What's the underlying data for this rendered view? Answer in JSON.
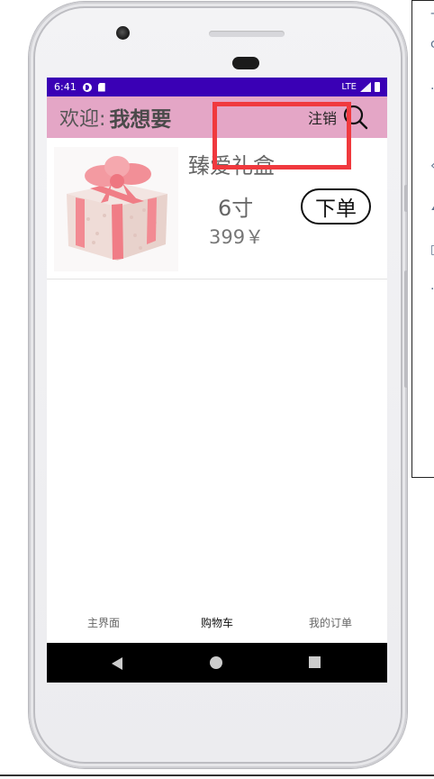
{
  "status_bar": {
    "time": "6:41",
    "network": "LTE"
  },
  "app_bar": {
    "welcome_label": "欢迎:",
    "username": "我想要",
    "logout_label": "注销"
  },
  "cart_item": {
    "name": "臻爱礼盒",
    "size": "6寸",
    "price": "399￥",
    "order_button": "下单"
  },
  "tabs": [
    {
      "label": "主界面"
    },
    {
      "label": "购物车"
    },
    {
      "label": "我的订单"
    }
  ],
  "colors": {
    "status_bar": "#3a00b5",
    "app_bar": "#e4a6c6",
    "highlight": "#f0393e"
  }
}
